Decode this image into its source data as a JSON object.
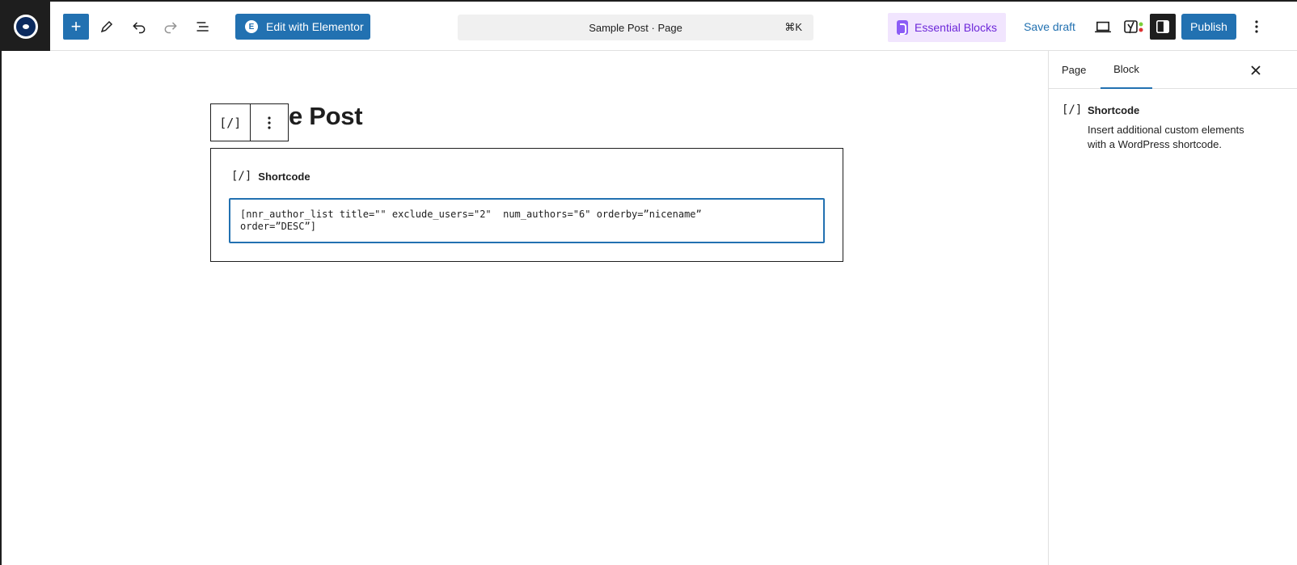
{
  "topbar": {
    "add_label": "+",
    "elementor_label": "Edit with Elementor",
    "elementor_icon": "E",
    "command_title": "Sample Post · Page",
    "command_shortcut": "⌘K",
    "essential_blocks_label": "Essential Blocks",
    "save_draft_label": "Save draft",
    "yoast_label": "y",
    "publish_label": "Publish"
  },
  "editor": {
    "title": "e Post",
    "block_toolbar_icon": "[/]",
    "shortcode_label": "Shortcode",
    "shortcode_icon": "[/]",
    "shortcode_value": "[nnr_author_list title=\"\" exclude_users=\"2\"  num_authors=\"6\" orderby=”nicename”\norder=”DESC”]"
  },
  "sidebar": {
    "tabs": [
      {
        "label": "Page"
      },
      {
        "label": "Block"
      }
    ],
    "active_tab": "Block",
    "block_icon": "[/]",
    "block_title": "Shortcode",
    "block_description": "Insert additional custom elements with a WordPress shortcode."
  },
  "colors": {
    "accent": "#2271b1",
    "essential_blocks_bg": "#f1e5fe",
    "essential_blocks_text": "#6d28d9"
  }
}
